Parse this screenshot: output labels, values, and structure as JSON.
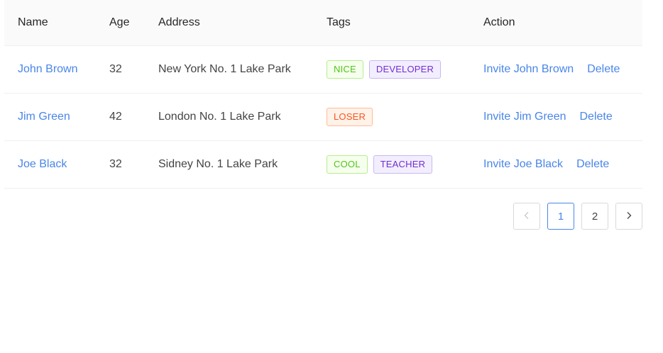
{
  "table": {
    "columns": [
      "Name",
      "Age",
      "Address",
      "Tags",
      "Action"
    ],
    "rows": [
      {
        "name": "John Brown",
        "age": "32",
        "address": "New York No. 1 Lake Park",
        "tags": [
          "NICE",
          "DEVELOPER"
        ],
        "invite": "Invite John Brown",
        "delete": "Delete"
      },
      {
        "name": "Jim Green",
        "age": "42",
        "address": "London No. 1 Lake Park",
        "tags": [
          "LOSER"
        ],
        "invite": "Invite Jim Green",
        "delete": "Delete"
      },
      {
        "name": "Joe Black",
        "age": "32",
        "address": "Sidney No. 1 Lake Park",
        "tags": [
          "COOL",
          "TEACHER"
        ],
        "invite": "Invite Joe Black",
        "delete": "Delete"
      }
    ]
  },
  "pagination": {
    "pages": [
      "1",
      "2"
    ],
    "current": "1",
    "prev_icon": "chevron-left-icon",
    "next_icon": "chevron-right-icon"
  },
  "colors": {
    "link": "#4a86e8",
    "tag_green": "#52c41a",
    "tag_purple": "#722ed1",
    "tag_orange": "#fa541c"
  }
}
